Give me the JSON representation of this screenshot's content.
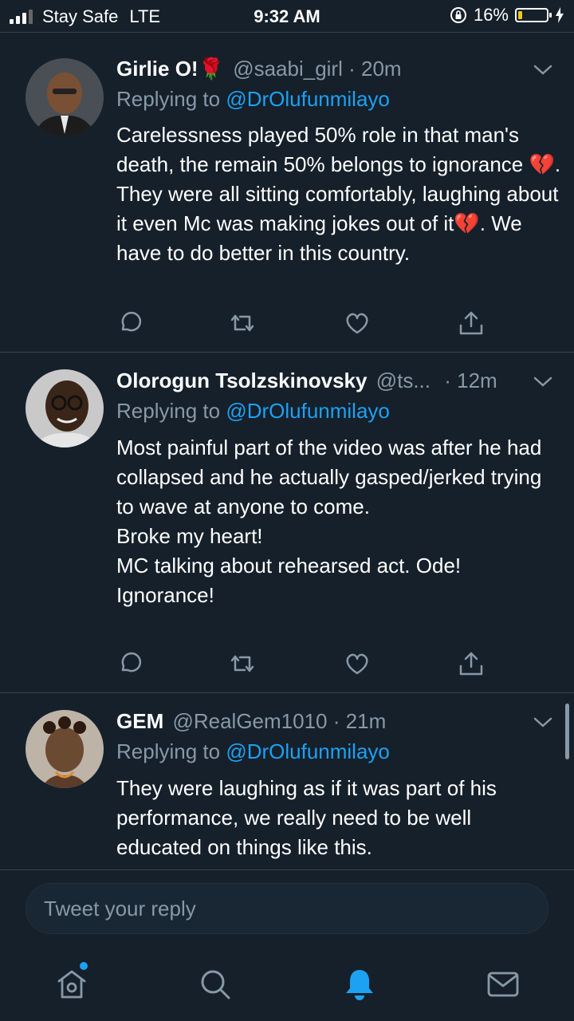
{
  "status": {
    "carrier": "Stay Safe",
    "network": "LTE",
    "time": "9:32 AM",
    "battery": "16%",
    "battery_level": 0.16,
    "battery_color": "#f5c518"
  },
  "tweets": [
    {
      "name": "Girlie O!🌹",
      "handle": "@saabi_girl",
      "time": "· 20m",
      "replying_prefix": "Replying to ",
      "replying_to": "@DrOlufunmilayo",
      "text": "Carelessness played 50% role in that man's death, the remain 50% belongs to ignorance 💔. They were all sitting comfortably, laughing about it even Mc was making jokes out of it💔. We have to do better in this country."
    },
    {
      "name": "Olorogun Tsolzskinovsky",
      "handle": "@ts...",
      "time": "· 12m",
      "replying_prefix": "Replying to ",
      "replying_to": "@DrOlufunmilayo",
      "text_lines": [
        "Most painful part of the video was after he had collapsed and he actually gasped/jerked trying to wave at anyone to come.",
        "Broke my heart!",
        "MC talking about rehearsed act. Ode! Ignorance!"
      ]
    },
    {
      "name": "GEM",
      "handle": "@RealGem1010",
      "time": "· 21m",
      "replying_prefix": "Replying to ",
      "replying_to": "@DrOlufunmilayo",
      "text": "They were laughing as if it was part of his performance, we really need to be well educated on things like this."
    }
  ],
  "composer": {
    "placeholder": "Tweet your reply"
  },
  "tabs": [
    "home-icon",
    "search-icon",
    "notifications-icon",
    "messages-icon"
  ],
  "colors": {
    "background": "#15202b",
    "accent": "#1da1f2",
    "secondary_text": "#8899a6",
    "divider": "#38444d"
  }
}
